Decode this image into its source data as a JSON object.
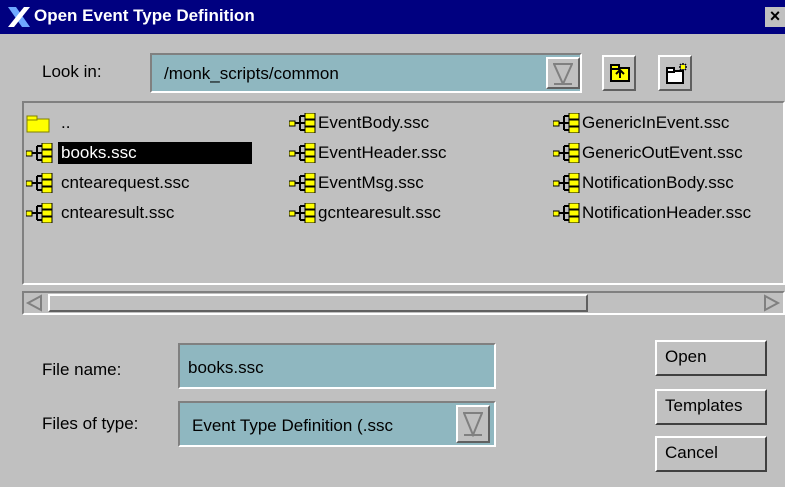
{
  "window": {
    "title": "Open Event Type Definition",
    "close_label": "×"
  },
  "look_in": {
    "label": "Look in:",
    "value": "/monk_scripts/common"
  },
  "toolbar": {
    "up_icon": "up-folder-icon",
    "new_folder_icon": "new-folder-icon"
  },
  "files": [
    {
      "name": "..",
      "icon": "folder-icon",
      "selected": false
    },
    {
      "name": "books.ssc",
      "icon": "event-type-icon",
      "selected": true
    },
    {
      "name": "cntearequest.ssc",
      "icon": "event-type-icon",
      "selected": false
    },
    {
      "name": "cntearesult.ssc",
      "icon": "event-type-icon",
      "selected": false
    },
    {
      "name": "EventBody.ssc",
      "icon": "event-type-icon",
      "selected": false
    },
    {
      "name": "EventHeader.ssc",
      "icon": "event-type-icon",
      "selected": false
    },
    {
      "name": "EventMsg.ssc",
      "icon": "event-type-icon",
      "selected": false
    },
    {
      "name": "gcntearesult.ssc",
      "icon": "event-type-icon",
      "selected": false
    },
    {
      "name": "GenericInEvent.ssc",
      "icon": "event-type-icon",
      "selected": false
    },
    {
      "name": "GenericOutEvent.ssc",
      "icon": "event-type-icon",
      "selected": false
    },
    {
      "name": "NotificationBody.ssc",
      "icon": "event-type-icon",
      "selected": false
    },
    {
      "name": "NotificationHeader.ssc",
      "icon": "event-type-icon",
      "selected": false
    }
  ],
  "file_name": {
    "label": "File name:",
    "value": "books.ssc"
  },
  "file_type": {
    "label": "Files of type:",
    "value": "Event Type Definition (.ssc"
  },
  "buttons": {
    "open": "Open",
    "templates": "Templates",
    "cancel": "Cancel"
  },
  "colors": {
    "titlebar": "#000080",
    "field": "#8fb7c0",
    "face": "#c0c0c0",
    "icon_yellow": "#ffff00"
  }
}
